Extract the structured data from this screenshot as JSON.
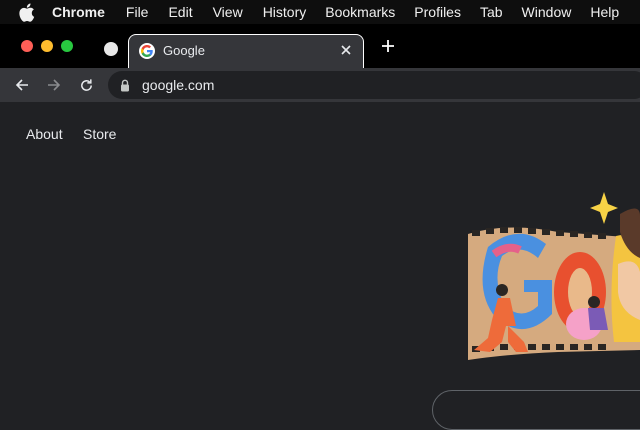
{
  "menubar": {
    "items": [
      "Chrome",
      "File",
      "Edit",
      "View",
      "History",
      "Bookmarks",
      "Profiles",
      "Tab",
      "Window",
      "Help"
    ]
  },
  "tab": {
    "title": "Google"
  },
  "omnibox": {
    "url": "google.com"
  },
  "page": {
    "links": [
      "About",
      "Store"
    ]
  },
  "colors": {
    "background": "#202124",
    "toolbar": "#35363a",
    "menubar": "#0e0e0e"
  }
}
